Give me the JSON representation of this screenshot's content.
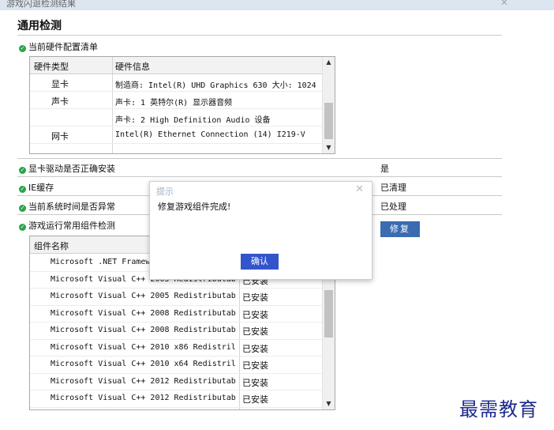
{
  "window": {
    "title": "游戏闪退检测结果",
    "close": "✕"
  },
  "section_title": "通用检测",
  "hardware": {
    "label": "当前硬件配置清单",
    "headers": [
      "硬件类型",
      "硬件信息"
    ],
    "rows": [
      {
        "type": "显卡",
        "info": "制造商: Intel(R) UHD Graphics 630 大小: 1024"
      },
      {
        "type": "声卡",
        "info": "声卡: 1 英特尔(R) 显示器音频"
      },
      {
        "type": "",
        "info": "声卡: 2 High Definition Audio 设备"
      },
      {
        "type": "网卡",
        "info": "Intel(R) Ethernet Connection (14) I219-V"
      }
    ]
  },
  "checks": [
    {
      "label": "显卡驱动是否正确安装",
      "value": "是"
    },
    {
      "label": "IE缓存",
      "value": "已清理"
    },
    {
      "label": "当前系统时间是否异常",
      "value": "已处理"
    },
    {
      "label": "游戏运行常用组件检测",
      "button": "修复"
    }
  ],
  "components": {
    "header": "组件名称",
    "rows": [
      {
        "name": "Microsoft .NET Framew",
        "status": ""
      },
      {
        "name": "Microsoft Visual C++ 2005 Redistributab",
        "status": "已安装"
      },
      {
        "name": "Microsoft Visual C++ 2005 Redistributab",
        "status": "已安装"
      },
      {
        "name": "Microsoft Visual C++ 2008 Redistributab",
        "status": "已安装"
      },
      {
        "name": "Microsoft Visual C++ 2008 Redistributab",
        "status": "已安装"
      },
      {
        "name": "Microsoft Visual C++ 2010  x86 Redistril",
        "status": "已安装"
      },
      {
        "name": "Microsoft Visual C++ 2010  x64 Redistril",
        "status": "已安装"
      },
      {
        "name": "Microsoft Visual C++ 2012 Redistributab",
        "status": "已安装"
      },
      {
        "name": "Microsoft Visual C++ 2012 Redistributab",
        "status": "已安装"
      }
    ]
  },
  "dialog": {
    "title": "提示",
    "message": "修复游戏组件完成!",
    "confirm": "确认",
    "close": "✕"
  },
  "watermark": "最需教育",
  "colors": {
    "accent": "#3b6bb0",
    "check": "#2aa44a",
    "dialog_button": "#3355cc"
  }
}
